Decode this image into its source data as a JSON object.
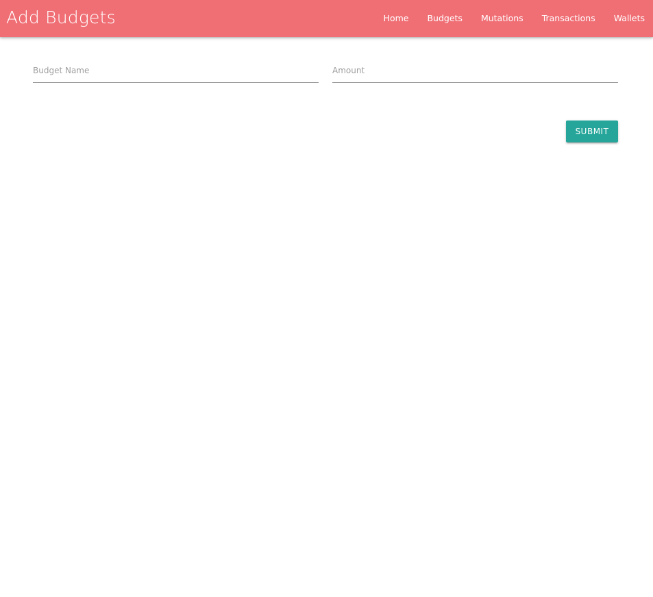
{
  "navbar": {
    "title": "Add Budgets",
    "background_color": "#f06f75",
    "links": [
      {
        "label": "Home"
      },
      {
        "label": "Budgets"
      },
      {
        "label": "Mutations"
      },
      {
        "label": "Transactions"
      },
      {
        "label": "Wallets"
      }
    ]
  },
  "form": {
    "budget_name": {
      "placeholder": "Budget Name",
      "value": ""
    },
    "amount": {
      "placeholder": "Amount",
      "value": ""
    },
    "submit_label": "SUBMIT",
    "submit_color": "#26a69a"
  }
}
